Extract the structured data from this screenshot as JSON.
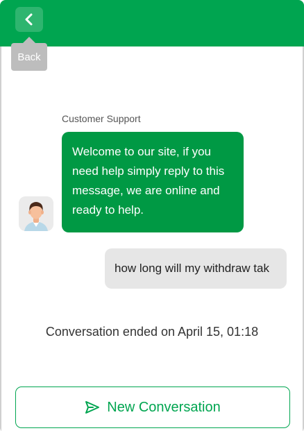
{
  "header": {
    "back_icon": "chevron-left-icon",
    "back_tooltip": "Back",
    "color": "#00a550"
  },
  "conversation": {
    "agent_name": "Customer Support",
    "avatar_icon": "support-agent-avatar",
    "messages": [
      {
        "from": "agent",
        "text": "Welcome to our site, if you need help simply reply to this message, we are online and ready to help."
      },
      {
        "from": "user",
        "text": "how long will my withdraw tak"
      }
    ],
    "ended_text": "Conversation ended on April 15, 01:18"
  },
  "footer": {
    "new_conversation_label": "New Conversation",
    "new_conversation_icon": "send-icon"
  },
  "colors": {
    "brand": "#00a550",
    "agent_bubble": "#009944",
    "user_bubble": "#e6e6e6"
  }
}
